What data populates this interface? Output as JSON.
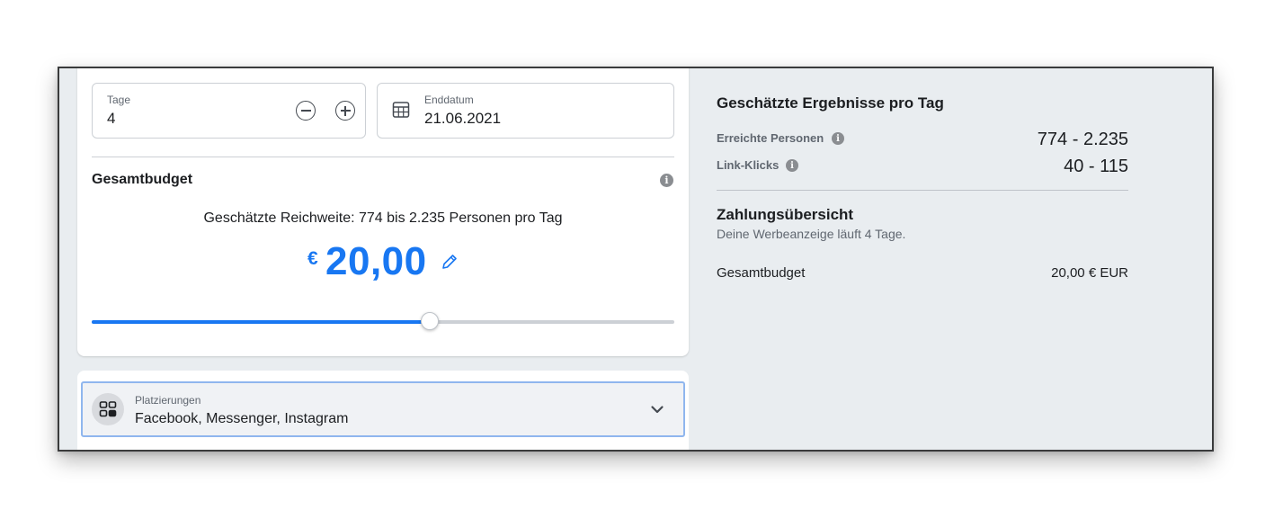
{
  "duration": {
    "days_label": "Tage",
    "days_value": "4",
    "end_label": "Enddatum",
    "end_value": "21.06.2021"
  },
  "budget": {
    "title": "Gesamtbudget",
    "reach_text": "Geschätzte Reichweite: 774 bis 2.235 Personen pro Tag",
    "currency_symbol": "€",
    "amount": "20,00",
    "slider_fraction": 0.58
  },
  "placements": {
    "label": "Platzierungen",
    "value": "Facebook, Messenger, Instagram"
  },
  "results": {
    "title": "Geschätzte Ergebnisse pro Tag",
    "metrics": [
      {
        "label": "Erreichte Personen",
        "value": "774 - 2.235"
      },
      {
        "label": "Link-Klicks",
        "value": "40 - 115"
      }
    ]
  },
  "payment": {
    "title": "Zahlungsübersicht",
    "subtitle": "Deine Werbeanzeige läuft 4 Tage.",
    "total_label": "Gesamtbudget",
    "total_value": "20,00 € EUR"
  },
  "colors": {
    "accent": "#1877f2",
    "panel_bg": "#e9edf0",
    "focus_border": "#8fb6ee"
  },
  "icons": [
    "minus-circle-icon",
    "plus-circle-icon",
    "calendar-icon",
    "info-icon",
    "pencil-icon",
    "placements-grid-icon",
    "chevron-down-icon"
  ]
}
